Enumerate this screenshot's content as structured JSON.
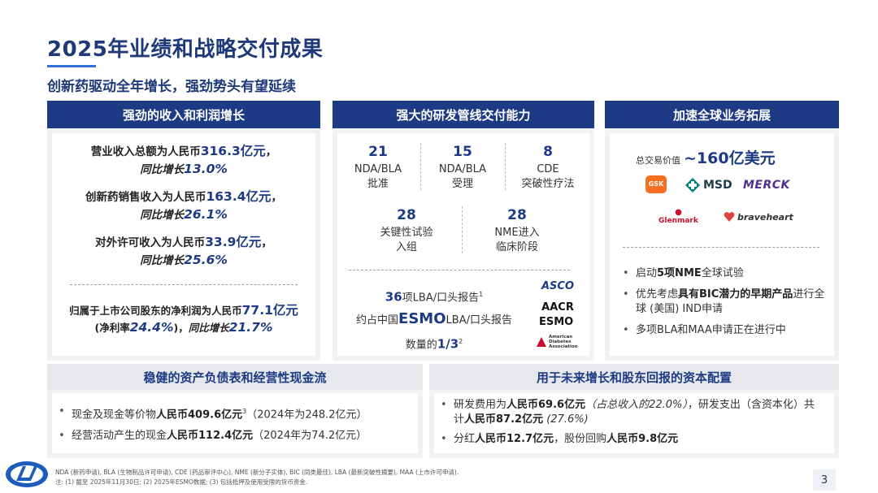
{
  "header": {
    "title": "2025年业绩和战略交付成果",
    "subtitle": "创新药驱动全年增长，强劲势头有望延续"
  },
  "panel_revenue": {
    "heading": "强劲的收入和利润增长",
    "items": [
      {
        "prefix": "营业收入总额为人民币",
        "value": "316.3亿元",
        "suffix": "，",
        "yoy_prefix": "同比增长",
        "yoy_value": "13.0%"
      },
      {
        "prefix": "创新药销售收入为人民币",
        "value": "163.4亿元",
        "suffix": "，",
        "yoy_prefix": "同比增长",
        "yoy_value": "26.1%"
      },
      {
        "prefix": "对外许可收入为人民币",
        "value": "33.9亿元",
        "suffix": "，",
        "yoy_prefix": "同比增长",
        "yoy_value": "25.6%"
      }
    ],
    "net_profit": {
      "prefix": "归属于上市公司股东的净利润为人民币",
      "value": "77.1亿元",
      "margin_prefix": "(净利率",
      "margin_value": "24.4%",
      "margin_suffix": ")，",
      "yoy_prefix": "同比增长",
      "yoy_value": "21.7%"
    }
  },
  "panel_pipeline": {
    "heading": "强大的研发管线交付能力",
    "stats_row1": [
      {
        "value": "21",
        "line1": "NDA/BLA",
        "line2": "批准"
      },
      {
        "value": "15",
        "line1": "NDA/BLA",
        "line2": "受理"
      },
      {
        "value": "8",
        "line1": "CDE",
        "line2": "突破性疗法"
      }
    ],
    "stats_row2": [
      {
        "value": "28",
        "line1": "关键性试验",
        "line2": "入组"
      },
      {
        "value": "28",
        "line1": "NME进入",
        "line2": "临床阶段"
      }
    ],
    "esmo": {
      "count": "36",
      "line1_rest": "项LBA/口头报告",
      "line1_sup": "1",
      "line2_pre": "约占中国",
      "line2_esmo": "ESMO",
      "line2_rest": "LBA/口头报告",
      "line3_pre": "数量的",
      "line3_value": "1/3",
      "line3_sup": "2"
    },
    "logos": [
      "ASCO",
      "AACR",
      "ESMO",
      "American Diabetes Association"
    ]
  },
  "panel_global": {
    "heading": "加速全球业务拓展",
    "deal_label": "总交易价值",
    "deal_value": "~160亿美元",
    "partners": [
      "GSK",
      "MSD",
      "MERCK",
      "Glenmark",
      "braveheart"
    ],
    "bullets": [
      {
        "pre": "启动",
        "bold": "5项NME",
        "post": "全球试验"
      },
      {
        "pre": "优先考虑",
        "bold": "具有BIC潜力的早期产品",
        "post": "进行全球 (美国) IND申请"
      },
      {
        "pre": "多项BLA和MAA申请正在进行中",
        "bold": "",
        "post": ""
      }
    ]
  },
  "panel_balance": {
    "heading": "稳健的资产负债表和经营性现金流",
    "bullets": [
      {
        "pre": "现金及现金等价物",
        "bold": "人民币409.6亿元",
        "sup": "3",
        "post": "（2024年为248.2亿元）"
      },
      {
        "pre": "经营活动产生的现金",
        "bold": "人民币112.4亿元",
        "sup": "",
        "post": "（2024年为74.2亿元）"
      }
    ]
  },
  "panel_capital": {
    "heading": "用于未来增长和股东回报的资本配置",
    "bullet1": {
      "pre": "研发费用为",
      "bold1": "人民币69.6亿元",
      "ital1": "（占总收入的22.0%）",
      "mid": "，研发支出（含资本化）共计",
      "bold2": "人民币87.2亿元",
      "ital2": "(27.6%)"
    },
    "bullet2": {
      "pre": "分红",
      "bold1": "人民币12.7亿元",
      "mid": "，股份回购",
      "bold2": "人民币9.8亿元"
    }
  },
  "footer": {
    "abbrev": "NDA (新药申请), BLA (生物制品许可申请), CDE (药品审评中心), NME (新分子实体), BIC (同类最佳), LBA (最新突破性摘要), MAA (上市许可申请).",
    "notes": "注: (1) 截至 2025年11月30日; (2) 2025年ESMO数据; (3) 包括抵押及使用受限的货币资金.",
    "page": "3"
  },
  "colors": {
    "navy": "#1d3a84",
    "accent_blue": "#2f6fd6",
    "panel_bg": "#f1f2f4"
  }
}
